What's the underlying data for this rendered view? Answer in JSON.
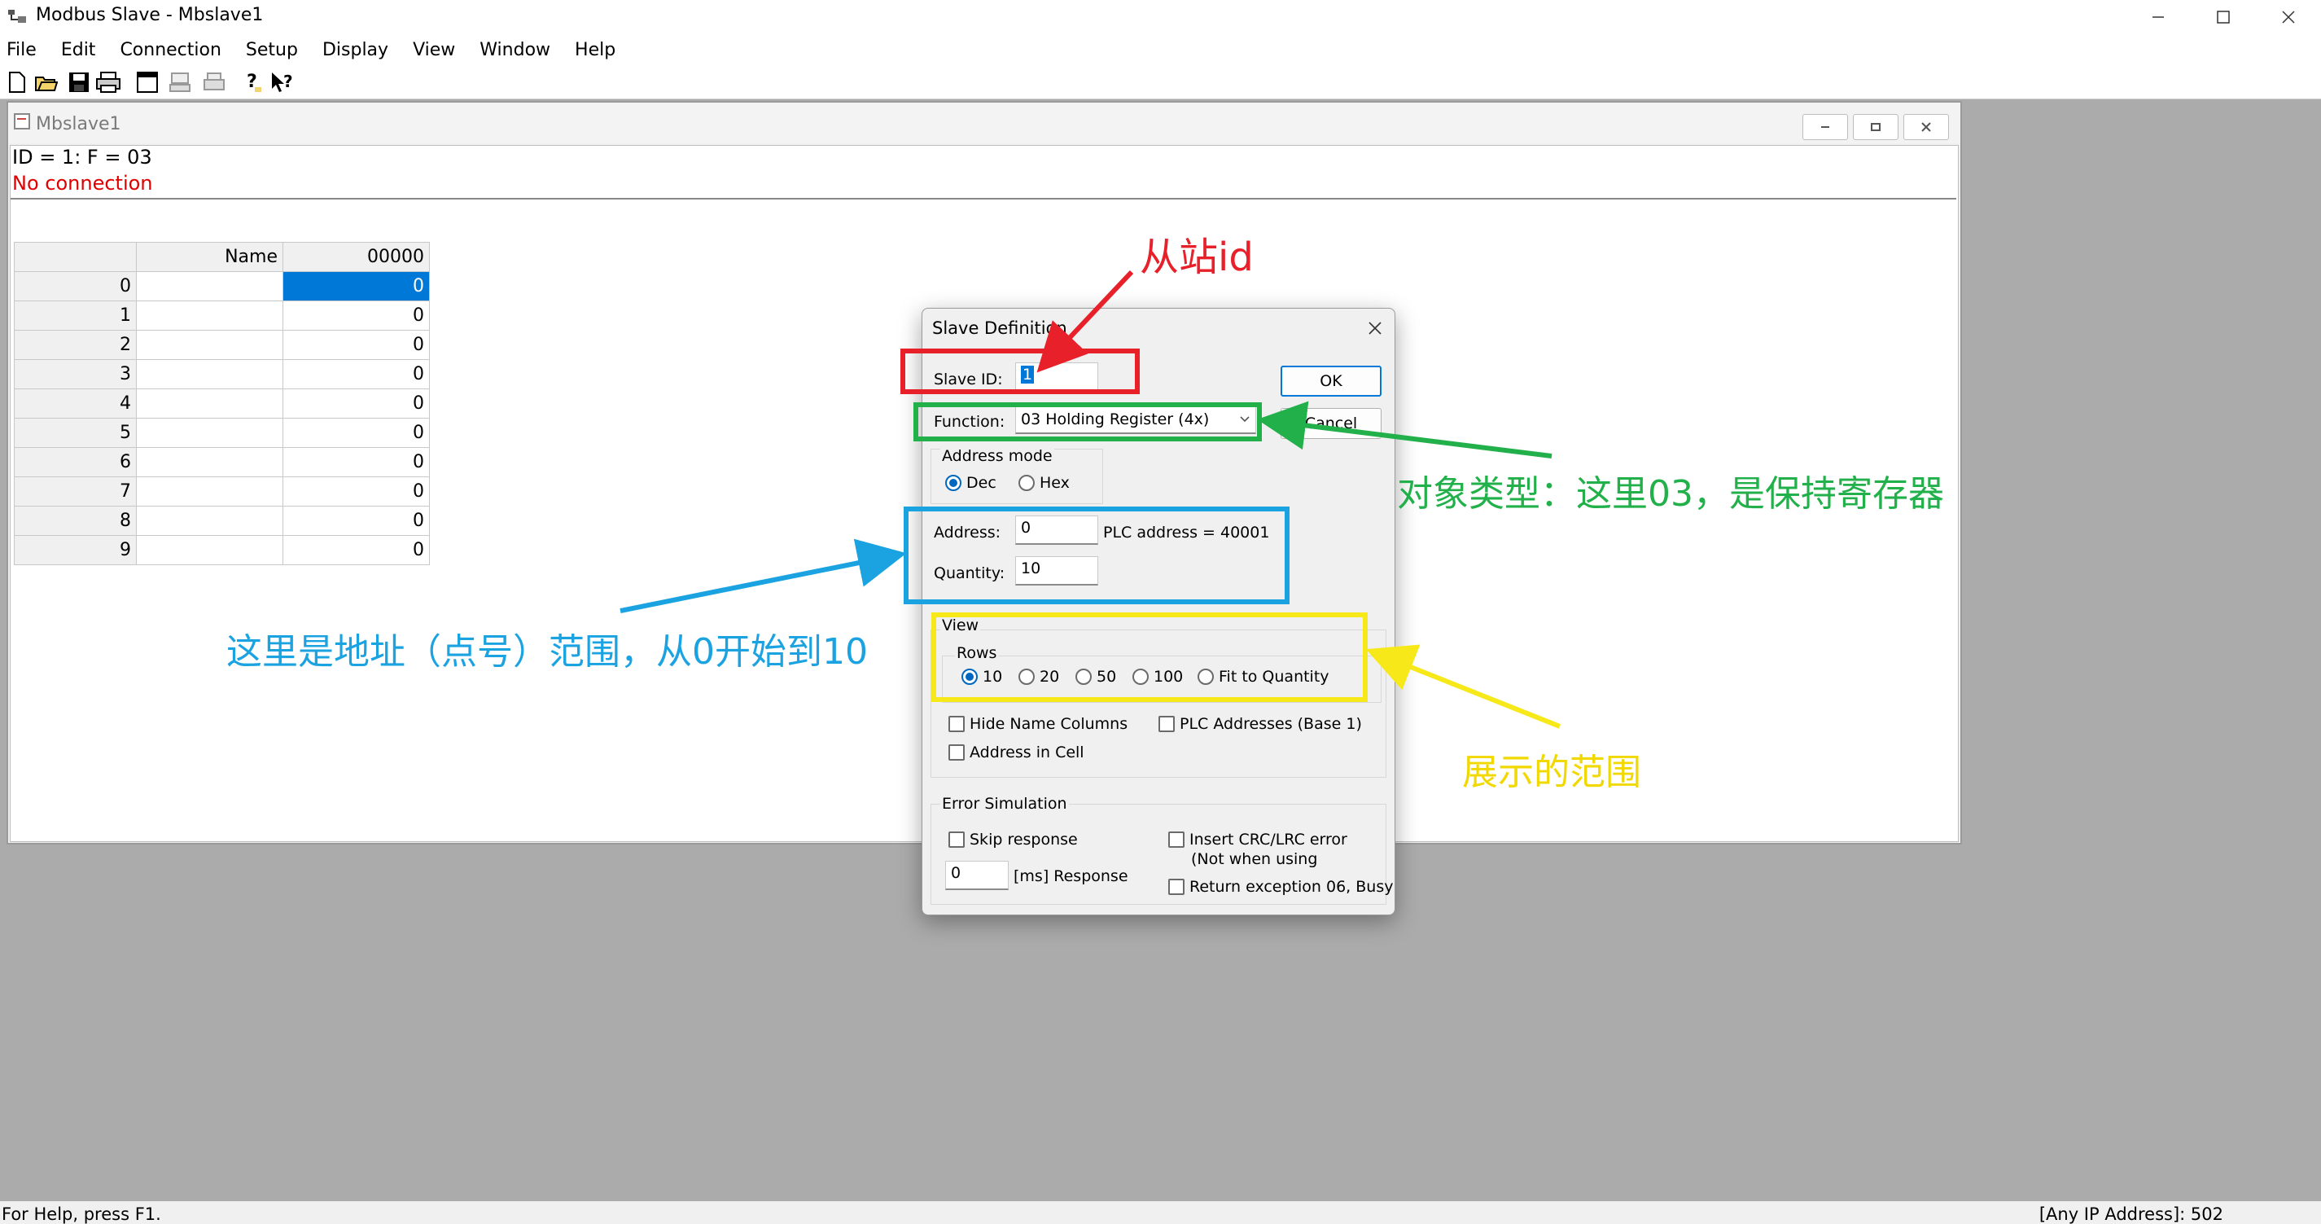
{
  "window": {
    "title": "Modbus Slave - Mbslave1"
  },
  "menu": [
    "File",
    "Edit",
    "Connection",
    "Setup",
    "Display",
    "View",
    "Window",
    "Help"
  ],
  "toolbar_icons": [
    "new-icon",
    "open-icon",
    "save-icon",
    "print-icon",
    "window-icon",
    "monitor-icon",
    "printer2-icon",
    "help-icon",
    "whats-this-icon"
  ],
  "child": {
    "title": "Mbslave1",
    "info_id": "ID = 1: F = 03",
    "info_conn": "No connection",
    "grid": {
      "col_name": "Name",
      "col_addr": "00000",
      "rows": [
        {
          "idx": "0",
          "name": "",
          "value": "0"
        },
        {
          "idx": "1",
          "name": "",
          "value": "0"
        },
        {
          "idx": "2",
          "name": "",
          "value": "0"
        },
        {
          "idx": "3",
          "name": "",
          "value": "0"
        },
        {
          "idx": "4",
          "name": "",
          "value": "0"
        },
        {
          "idx": "5",
          "name": "",
          "value": "0"
        },
        {
          "idx": "6",
          "name": "",
          "value": "0"
        },
        {
          "idx": "7",
          "name": "",
          "value": "0"
        },
        {
          "idx": "8",
          "name": "",
          "value": "0"
        },
        {
          "idx": "9",
          "name": "",
          "value": "0"
        }
      ]
    }
  },
  "status": {
    "left": "For Help, press F1.",
    "right": "[Any IP Address]: 502"
  },
  "dialog": {
    "title": "Slave Definition",
    "slave_id_label": "Slave ID:",
    "slave_id_value": "1",
    "function_label": "Function:",
    "function_value": "03 Holding Register (4x)",
    "ok": "OK",
    "cancel": "Cancel",
    "address_mode": {
      "label": "Address mode",
      "options": [
        "Dec",
        "Hex"
      ],
      "selected": "Dec"
    },
    "address_label": "Address:",
    "address_value": "0",
    "plc_address": "PLC address = 40001",
    "quantity_label": "Quantity:",
    "quantity_value": "10",
    "view": {
      "label": "View",
      "rows_label": "Rows",
      "rows_options": [
        "10",
        "20",
        "50",
        "100",
        "Fit to Quantity"
      ],
      "rows_selected": "10",
      "hide_name": "Hide Name Columns",
      "plc_base1": "PLC Addresses (Base 1)",
      "addr_in_cell": "Address in Cell"
    },
    "error_sim": {
      "label": "Error Simulation",
      "skip_response": "Skip response",
      "delay_value": "0",
      "delay_label": "[ms] Response",
      "insert_crc": "Insert CRC/LRC error",
      "insert_crc_note": "(Not when using",
      "return_exception": "Return exception 06, Busy"
    }
  },
  "annotations": {
    "slave_id": "从站id",
    "function": "对象类型：这里03，是保持寄存器",
    "address_range": "这里是地址（点号）范围，从0开始到10",
    "view_range": "展示的范围",
    "colors": {
      "red": "#e8202a",
      "green": "#22b04a",
      "blue": "#1aa3e0",
      "yellow": "#f7e81a"
    }
  }
}
